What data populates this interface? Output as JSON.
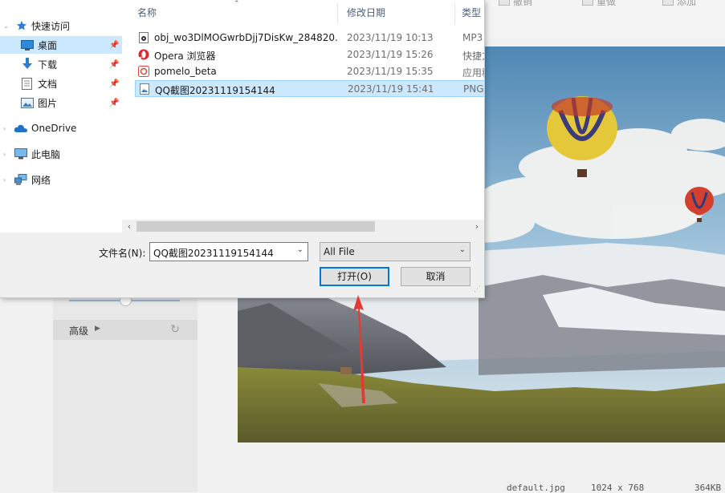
{
  "background": {
    "toolbar": {
      "item1": "撤销",
      "item2": "重做",
      "item3": "添加"
    },
    "advanced_label": "高级",
    "footer": {
      "filename": "default.jpg",
      "dimensions": "1024 x 768",
      "filesize": "364KB"
    }
  },
  "dialog": {
    "nav": {
      "quick_access": "快速访问",
      "items": [
        {
          "label": "桌面",
          "icon": "desktop-icon",
          "pinned": true,
          "selected": true
        },
        {
          "label": "下载",
          "icon": "download-icon",
          "pinned": true,
          "selected": false
        },
        {
          "label": "文档",
          "icon": "document-icon",
          "pinned": true,
          "selected": false
        },
        {
          "label": "图片",
          "icon": "picture-icon",
          "pinned": true,
          "selected": false
        }
      ],
      "onedrive": "OneDrive",
      "this_pc": "此电脑",
      "network": "网络"
    },
    "columns": {
      "name": "名称",
      "modified": "修改日期",
      "type": "类型"
    },
    "files": [
      {
        "name": "obj_wo3DlMOGwrbDjj7DisKw_284820...",
        "modified": "2023/11/19 10:13",
        "type": "MP3",
        "icon": "mp3-file-icon",
        "selected": false
      },
      {
        "name": "Opera 浏览器",
        "modified": "2023/11/19 15:26",
        "type": "快捷方",
        "icon": "opera-icon",
        "selected": false
      },
      {
        "name": "pomelo_beta",
        "modified": "2023/11/19 15:35",
        "type": "应用程",
        "icon": "app-icon",
        "selected": false
      },
      {
        "name": "QQ截图20231119154144",
        "modified": "2023/11/19 15:41",
        "type": "PNG",
        "icon": "png-file-icon",
        "selected": true
      }
    ],
    "filename_label": "文件名(N):",
    "filename_value": "QQ截图20231119154144",
    "filetype_value": "All File",
    "open_button": "打开(O)",
    "cancel_button": "取消"
  },
  "colors": {
    "selection": "#cce8ff",
    "accent": "#0078d7",
    "annotation_arrow": "#e53935"
  }
}
